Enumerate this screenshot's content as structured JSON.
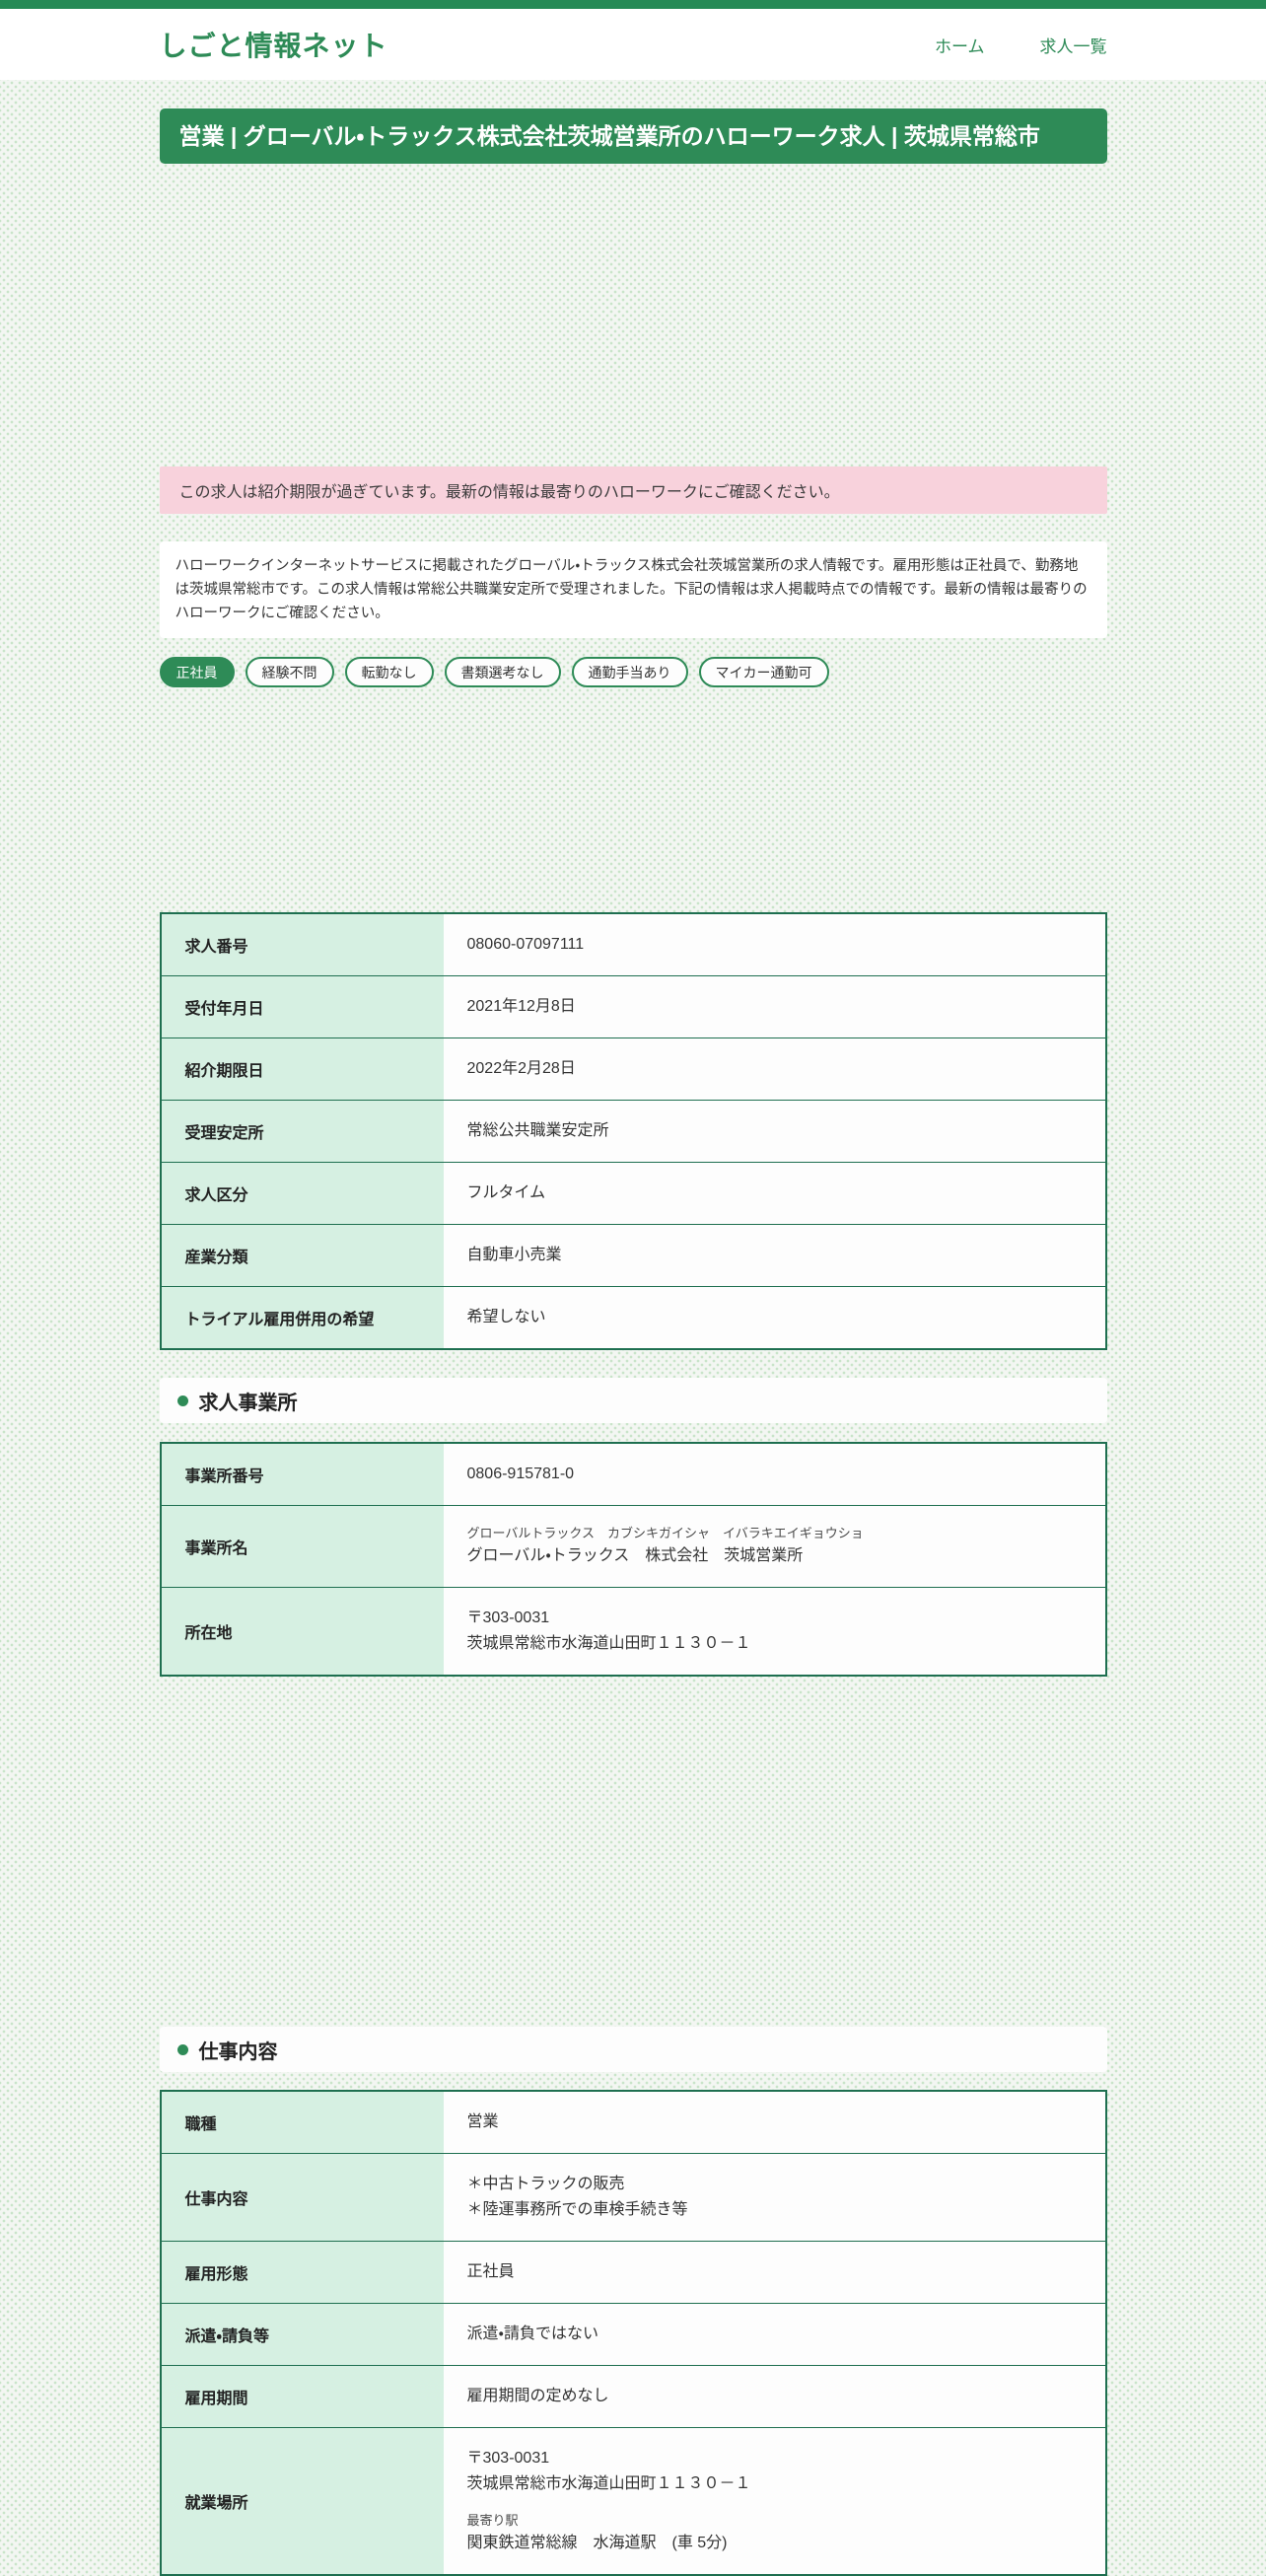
{
  "header": {
    "logo": "しごと情報ネット",
    "nav": [
      {
        "label": "ホーム"
      },
      {
        "label": "求人一覧"
      }
    ]
  },
  "page": {
    "title": "営業 | グローバル・トラックス株式会社茨城営業所のハローワーク求人 | 茨城県常総市"
  },
  "notice": {
    "expired_text": "この求人は紹介期限が過ぎています。最新の情報は最寄りのハローワークにご確認ください。"
  },
  "summary": {
    "text": "ハローワークインターネットサービスに掲載されたグローバル・トラックス株式会社茨城営業所の求人情報です。雇用形態は正社員で、勤務地は茨城県常総市です。この求人情報は常総公共職業安定所で受理されました。下記の情報は求人掲載時点での情報です。最新の情報は最寄りのハローワークにご確認ください。"
  },
  "tags": [
    {
      "label": "正社員",
      "filled": true
    },
    {
      "label": "経験不問",
      "filled": false
    },
    {
      "label": "転勤なし",
      "filled": false
    },
    {
      "label": "書類選考なし",
      "filled": false
    },
    {
      "label": "通勤手当あり",
      "filled": false
    },
    {
      "label": "マイカー通勤可",
      "filled": false
    }
  ],
  "sections": {
    "office": {
      "title": "求人事業所"
    },
    "job": {
      "title": "仕事内容"
    }
  },
  "tables": {
    "overview": {
      "rows": [
        {
          "label": "求人番号",
          "lines": [
            {
              "text": "08060-07097111"
            }
          ]
        },
        {
          "label": "受付年月日",
          "lines": [
            {
              "text": "2021年12月8日"
            }
          ]
        },
        {
          "label": "紹介期限日",
          "lines": [
            {
              "text": "2022年2月28日"
            }
          ]
        },
        {
          "label": "受理安定所",
          "lines": [
            {
              "text": "常総公共職業安定所"
            }
          ]
        },
        {
          "label": "求人区分",
          "lines": [
            {
              "text": "フルタイム"
            }
          ]
        },
        {
          "label": "産業分類",
          "lines": [
            {
              "text": "自動車小売業"
            }
          ]
        },
        {
          "label": "トライアル雇用併用の希望",
          "lines": [
            {
              "text": "希望しない"
            }
          ]
        }
      ]
    },
    "office": {
      "rows": [
        {
          "label": "事業所番号",
          "lines": [
            {
              "text": "0806-915781-0"
            }
          ]
        },
        {
          "label": "事業所名",
          "lines": [
            {
              "text": "グローバルトラックス　カブシキガイシャ　イバラキエイギョウショ",
              "small": true
            },
            {
              "text": "グローバル・トラックス　株式会社　茨城営業所"
            }
          ]
        },
        {
          "label": "所在地",
          "lines": [
            {
              "text": "〒303-0031"
            },
            {
              "text": "茨城県常総市水海道山田町１１３０－１"
            }
          ]
        }
      ]
    },
    "job": {
      "rows": [
        {
          "label": "職種",
          "lines": [
            {
              "text": "営業"
            }
          ]
        },
        {
          "label": "仕事内容",
          "lines": [
            {
              "text": "＊中古トラックの販売"
            },
            {
              "text": "＊陸運事務所での車検手続き等"
            }
          ]
        },
        {
          "label": "雇用形態",
          "lines": [
            {
              "text": "正社員"
            }
          ]
        },
        {
          "label": "派遣・請負等",
          "lines": [
            {
              "text": "派遣・請負ではない"
            }
          ]
        },
        {
          "label": "雇用期間",
          "lines": [
            {
              "text": "雇用期間の定めなし"
            }
          ]
        },
        {
          "label": "就業場所",
          "lines": [
            {
              "text": "〒303-0031"
            },
            {
              "text": "茨城県常総市水海道山田町１１３０－１"
            },
            {
              "text": "最寄り駅",
              "small": true,
              "gap": true
            },
            {
              "text": "関東鉄道常総線　水海道駅　(車 5分)"
            }
          ]
        }
      ]
    }
  }
}
